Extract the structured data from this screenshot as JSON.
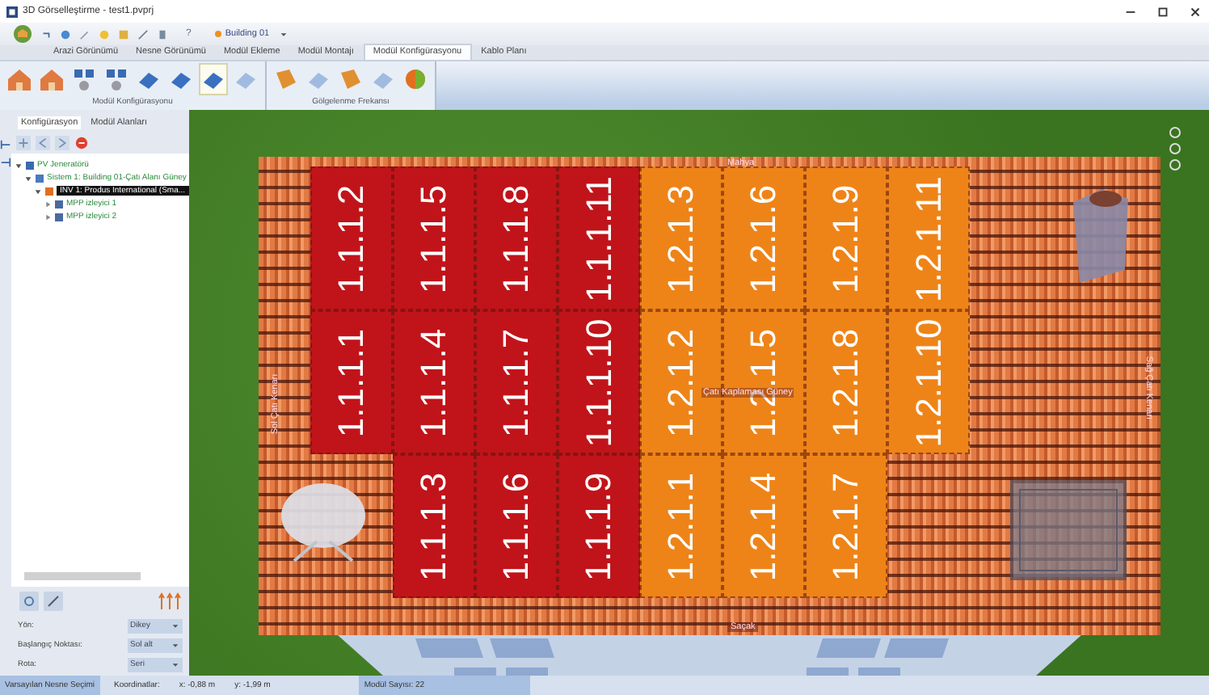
{
  "window": {
    "title": "3D Görselleştirme - test1.pvprj"
  },
  "quick_access": {
    "help": "?",
    "building": "Building 01"
  },
  "ribbon": {
    "tabs": [
      {
        "label": "Arazi Görünümü",
        "selected": false
      },
      {
        "label": "Nesne Görünümü",
        "selected": false
      },
      {
        "label": "Modül Ekleme",
        "selected": false
      },
      {
        "label": "Modül Montajı",
        "selected": false
      },
      {
        "label": "Modül Konfigürasyonu",
        "selected": true
      },
      {
        "label": "Kablo Planı",
        "selected": false
      }
    ],
    "groups": [
      {
        "label": "Modül Konfigürasyonu",
        "tools": [
          {
            "kind": "roof",
            "disabled": false,
            "selected": false
          },
          {
            "kind": "roof",
            "disabled": false,
            "selected": false
          },
          {
            "kind": "grid",
            "disabled": false,
            "selected": false
          },
          {
            "kind": "grid",
            "disabled": false,
            "selected": false
          },
          {
            "kind": "panel",
            "disabled": false,
            "selected": false
          },
          {
            "kind": "panel",
            "disabled": false,
            "selected": false
          },
          {
            "kind": "panel",
            "disabled": false,
            "selected": true
          },
          {
            "kind": "panel",
            "disabled": true,
            "selected": false
          }
        ]
      },
      {
        "label": "Gölgelenme Frekansı",
        "tools": [
          {
            "kind": "shade",
            "disabled": false,
            "selected": false
          },
          {
            "kind": "panel",
            "disabled": true,
            "selected": false
          },
          {
            "kind": "shade",
            "disabled": false,
            "selected": false
          },
          {
            "kind": "panel",
            "disabled": true,
            "selected": false
          },
          {
            "kind": "ball",
            "disabled": false,
            "selected": false
          }
        ]
      }
    ]
  },
  "panel": {
    "tabs": [
      {
        "label": "Konfigürasyon",
        "selected": true
      },
      {
        "label": "Modül Alanları",
        "selected": false
      }
    ],
    "tree": [
      {
        "label": "PV Jeneratörü",
        "kind": "generator",
        "selected": false,
        "expanded": true,
        "children": [
          {
            "label": "Sistem 1: Building 01-Çatı Alanı Güney",
            "kind": "system",
            "selected": false,
            "expanded": true,
            "children": [
              {
                "label": "INV 1: Produs International (Sma...",
                "kind": "inverter",
                "selected": true,
                "expanded": true,
                "children": [
                  {
                    "label": "MPP izleyici 1",
                    "kind": "mpp",
                    "selected": false,
                    "expanded": false
                  },
                  {
                    "label": "MPP izleyici 2",
                    "kind": "mpp",
                    "selected": false,
                    "expanded": false
                  }
                ]
              }
            ]
          }
        ]
      }
    ],
    "fields": [
      {
        "label": "Yön:",
        "value": "Dikey"
      },
      {
        "label": "Başlangıç Noktası:",
        "value": "Sol alt"
      },
      {
        "label": "Rota:",
        "value": "Seri"
      }
    ]
  },
  "roof": {
    "ridge": "Mahya",
    "eave": "Saçak",
    "center": "Çatı Kaplaması Güney",
    "left_edge": "Sol Çatı Kenarı",
    "right_edge": "Sağ Çatı Kenarı",
    "columns": [
      {
        "cells": [
          {
            "label": "1.1.1.2",
            "color": "#c0141a"
          },
          {
            "label": "1.1.1.1",
            "color": "#c0141a"
          }
        ]
      },
      {
        "cells": [
          {
            "label": "1.1.1.5",
            "color": "#c0141a"
          },
          {
            "label": "1.1.1.4",
            "color": "#c0141a"
          },
          {
            "label": "1.1.1.3",
            "color": "#c0141a"
          }
        ]
      },
      {
        "cells": [
          {
            "label": "1.1.1.8",
            "color": "#c0141a"
          },
          {
            "label": "1.1.1.7",
            "color": "#c0141a"
          },
          {
            "label": "1.1.1.6",
            "color": "#c0141a"
          }
        ]
      },
      {
        "cells": [
          {
            "label": "1.1.1.11",
            "color": "#c0141a"
          },
          {
            "label": "1.1.1.10",
            "color": "#c0141a"
          },
          {
            "label": "1.1.1.9",
            "color": "#c0141a"
          }
        ]
      },
      {
        "cells": [
          {
            "label": "1.2.1.3",
            "color": "#ee8418"
          },
          {
            "label": "1.2.1.2",
            "color": "#ee8418"
          },
          {
            "label": "1.2.1.1",
            "color": "#ee8418"
          }
        ]
      },
      {
        "cells": [
          {
            "label": "1.2.1.6",
            "color": "#ee8418"
          },
          {
            "label": "1.2.1.5",
            "color": "#ee8418"
          },
          {
            "label": "1.2.1.4",
            "color": "#ee8418"
          }
        ]
      },
      {
        "cells": [
          {
            "label": "1.2.1.9",
            "color": "#ee8418"
          },
          {
            "label": "1.2.1.8",
            "color": "#ee8418"
          },
          {
            "label": "1.2.1.7",
            "color": "#ee8418"
          }
        ]
      },
      {
        "cells": [
          {
            "label": "1.2.1.11",
            "color": "#ee8418"
          },
          {
            "label": "1.2.1.10",
            "color": "#ee8418"
          }
        ]
      }
    ]
  },
  "status_bar": {
    "mode": "Varsayılan Nesne Seçimi",
    "coords_label": "Koordinatlar:",
    "x": "x: -0,88 m",
    "y": "y: -1,99 m",
    "module_count": "Modül Sayısı: 22"
  }
}
